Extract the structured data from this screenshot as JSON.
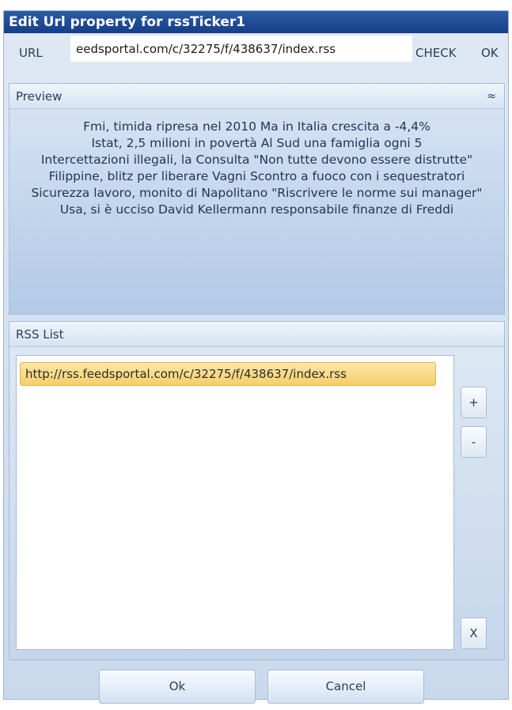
{
  "window": {
    "title": "Edit Url property for rssTicker1"
  },
  "url_row": {
    "label": "URL",
    "value": "eedsportal.com/c/32275/f/438637/index.rss",
    "check_label": "CHECK",
    "ok_label": "OK"
  },
  "preview": {
    "header": "Preview",
    "collapse_glyph": "≈",
    "lines": [
      "Fmi, timida ripresa nel 2010 Ma in Italia crescita a -4,4%",
      "Istat, 2,5 milioni in povertà Al Sud una famiglia ogni 5",
      "Intercettazioni illegali, la Consulta \"Non tutte devono essere distrutte\"",
      "Filippine, blitz per liberare Vagni Scontro a fuoco con i sequestratori",
      "Sicurezza lavoro, monito di Napolitano \"Riscrivere le norme sui manager\"",
      "Usa, si è ucciso David Kellermann responsabile finanze di Freddi"
    ]
  },
  "rss_list": {
    "header": "RSS List",
    "items": [
      "http://rss.feedsportal.com/c/32275/f/438637/index.rss"
    ],
    "add_label": "+",
    "remove_label": "-",
    "clear_label": "X"
  },
  "footer": {
    "ok_label": "Ok",
    "cancel_label": "Cancel"
  }
}
